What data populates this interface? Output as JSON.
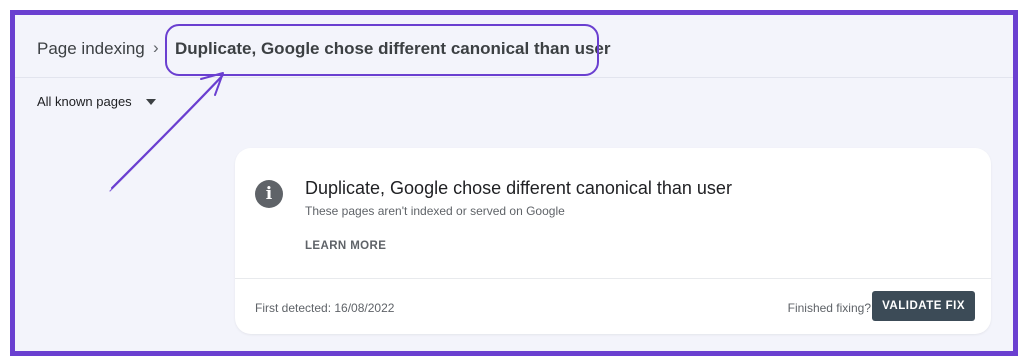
{
  "breadcrumb": {
    "root": "Page indexing",
    "separator": "›",
    "current": "Duplicate, Google chose different canonical than user"
  },
  "filter": {
    "selected": "All known pages"
  },
  "card": {
    "info_icon": "i",
    "title": "Duplicate, Google chose different canonical than user",
    "subtitle": "These pages aren't indexed or served on Google",
    "learn_more": "LEARN MORE",
    "first_detected": "First detected: 16/08/2022",
    "finished_fixing": "Finished fixing?",
    "validate_fix": "VALIDATE FIX"
  },
  "colors": {
    "annotation": "#6a3fd0",
    "button_bg": "#3c4b57",
    "page_bg": "#f3f4fb"
  }
}
